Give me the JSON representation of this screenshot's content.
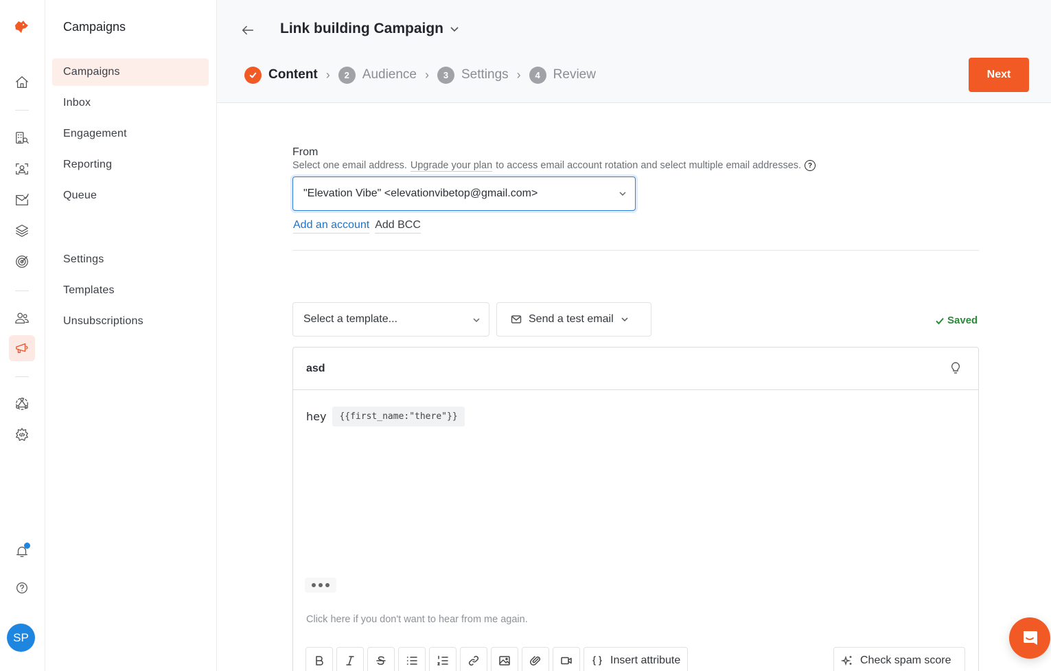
{
  "rail": {
    "logo": "fox-logo",
    "items": [
      {
        "name": "home",
        "icon": "home-icon"
      },
      {
        "name": "company-search",
        "icon": "building-search-icon"
      },
      {
        "name": "contact-scan",
        "icon": "user-scan-icon"
      },
      {
        "name": "email-verify",
        "icon": "mail-check-icon"
      },
      {
        "name": "layers",
        "icon": "layers-icon"
      },
      {
        "name": "target",
        "icon": "target-icon"
      },
      {
        "name": "contacts",
        "icon": "users-icon"
      },
      {
        "name": "campaigns",
        "icon": "megaphone-icon",
        "active": true
      },
      {
        "name": "integrations",
        "icon": "network-icon"
      },
      {
        "name": "developer",
        "icon": "code-gear-icon"
      }
    ],
    "avatar_initials": "SP",
    "avatar_color": "#1f86e0"
  },
  "sidebar": {
    "title": "Campaigns",
    "items": [
      {
        "label": "Campaigns",
        "active": true
      },
      {
        "label": "Inbox"
      },
      {
        "label": "Engagement"
      },
      {
        "label": "Reporting"
      },
      {
        "label": "Queue"
      },
      {
        "label": "Settings"
      },
      {
        "label": "Templates"
      },
      {
        "label": "Unsubscriptions"
      }
    ]
  },
  "header": {
    "campaign_title": "Link building Campaign",
    "steps": [
      {
        "number": "1",
        "label": "Content",
        "state": "done"
      },
      {
        "number": "2",
        "label": "Audience",
        "state": "pending"
      },
      {
        "number": "3",
        "label": "Settings",
        "state": "pending"
      },
      {
        "number": "4",
        "label": "Review",
        "state": "pending"
      }
    ],
    "step_separator": "›",
    "next_label": "Next",
    "accent": "#f15a24"
  },
  "from": {
    "label": "From",
    "help_prefix": "Select one email address.",
    "help_upgrade": "Upgrade your plan",
    "help_suffix": "to access email account rotation and select multiple email addresses.",
    "selected": "\"Elevation Vibe\" <elevationvibetop@gmail.com>",
    "add_account": "Add an account",
    "add_bcc": "Add BCC"
  },
  "composer": {
    "template_placeholder": "Select a template...",
    "test_email_label": "Send a test email",
    "saved_label": "Saved",
    "subject": "asd",
    "body_greeting": "hey",
    "body_attribute": "{{first_name:\"there\"}}",
    "unsubscribe_text": "Click here if you don't want to hear from me again.",
    "toolbar": {
      "insert_attribute": "Insert attribute",
      "check_spam": "Check spam score"
    }
  }
}
